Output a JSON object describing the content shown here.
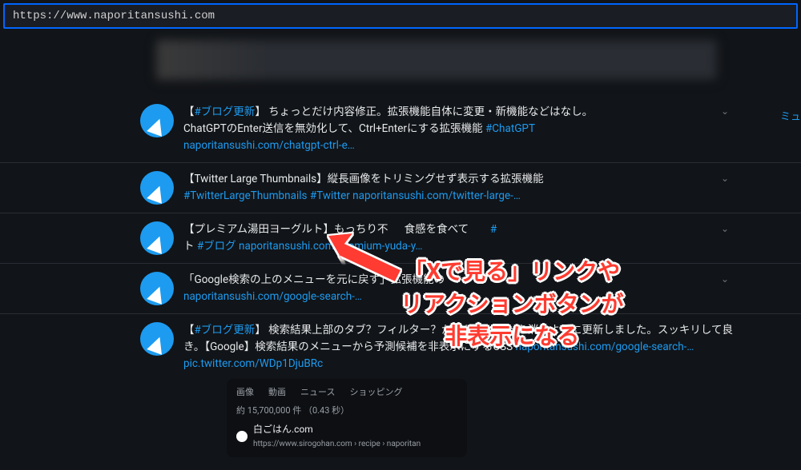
{
  "url": "https://www.naporitansushi.com",
  "sidebar_cut": "ミュ",
  "tweets": [
    {
      "prefix": "【",
      "tag": "#ブログ更新",
      "suffix": "】",
      "text1": " ちょっとだけ内容修正。拡張機能自体に変更・新機能などはなし。",
      "text2": "ChatGPTのEnter送信を無効化して、Ctrl+Enterにする拡張機能 ",
      "hash2": "#ChatGPT",
      "link": "naporitansushi.com/chatgpt-ctrl-e…"
    },
    {
      "prefix": "",
      "text1": "【Twitter Large Thumbnails】縦長画像をトリミングせず表示する拡張機能",
      "hash_line": "#TwitterLargeThumbnails #Twitter",
      "link": "naporitansushi.com/twitter-large-…"
    },
    {
      "text_before": "【プレミアム湯田ヨーグルト】もっちり不",
      "text_mid": "食感を食べて",
      "hash_hidden": "#",
      "text_after2": "ト ",
      "hash2": "#ブログ",
      "link": "naporitansushi.com/premium-yuda-y…"
    },
    {
      "text1": "「Google検索の上のメニューを元に戻す」拡張機能の",
      "link": "naporitansushi.com/google-search-…"
    },
    {
      "prefix": "【",
      "tag": "#ブログ更新",
      "suffix": "】",
      "text1": " 検索結果上部のタブ？フィルター？からサジェストを消すように更新しました。スッキリして良き。【Google】検索結果のメニューから予測候補を非表示にするCSS ",
      "link1": "naporitansushi.com/google-search-…",
      "link2": "pic.twitter.com/WDp1DjuBRc"
    }
  ],
  "embed": {
    "tabs": [
      "画像",
      "動画",
      "ニュース",
      "ショッピング"
    ],
    "stats": "約 15,700,000 件 （0.43 秒）",
    "title": "白ごはん.com",
    "url": "https://www.sirogohan.com › recipe › naporitan"
  },
  "annotation": {
    "line1": "「Xで見る」リンクや",
    "line2": "リアクションボタンが",
    "line3": "非表示になる"
  }
}
